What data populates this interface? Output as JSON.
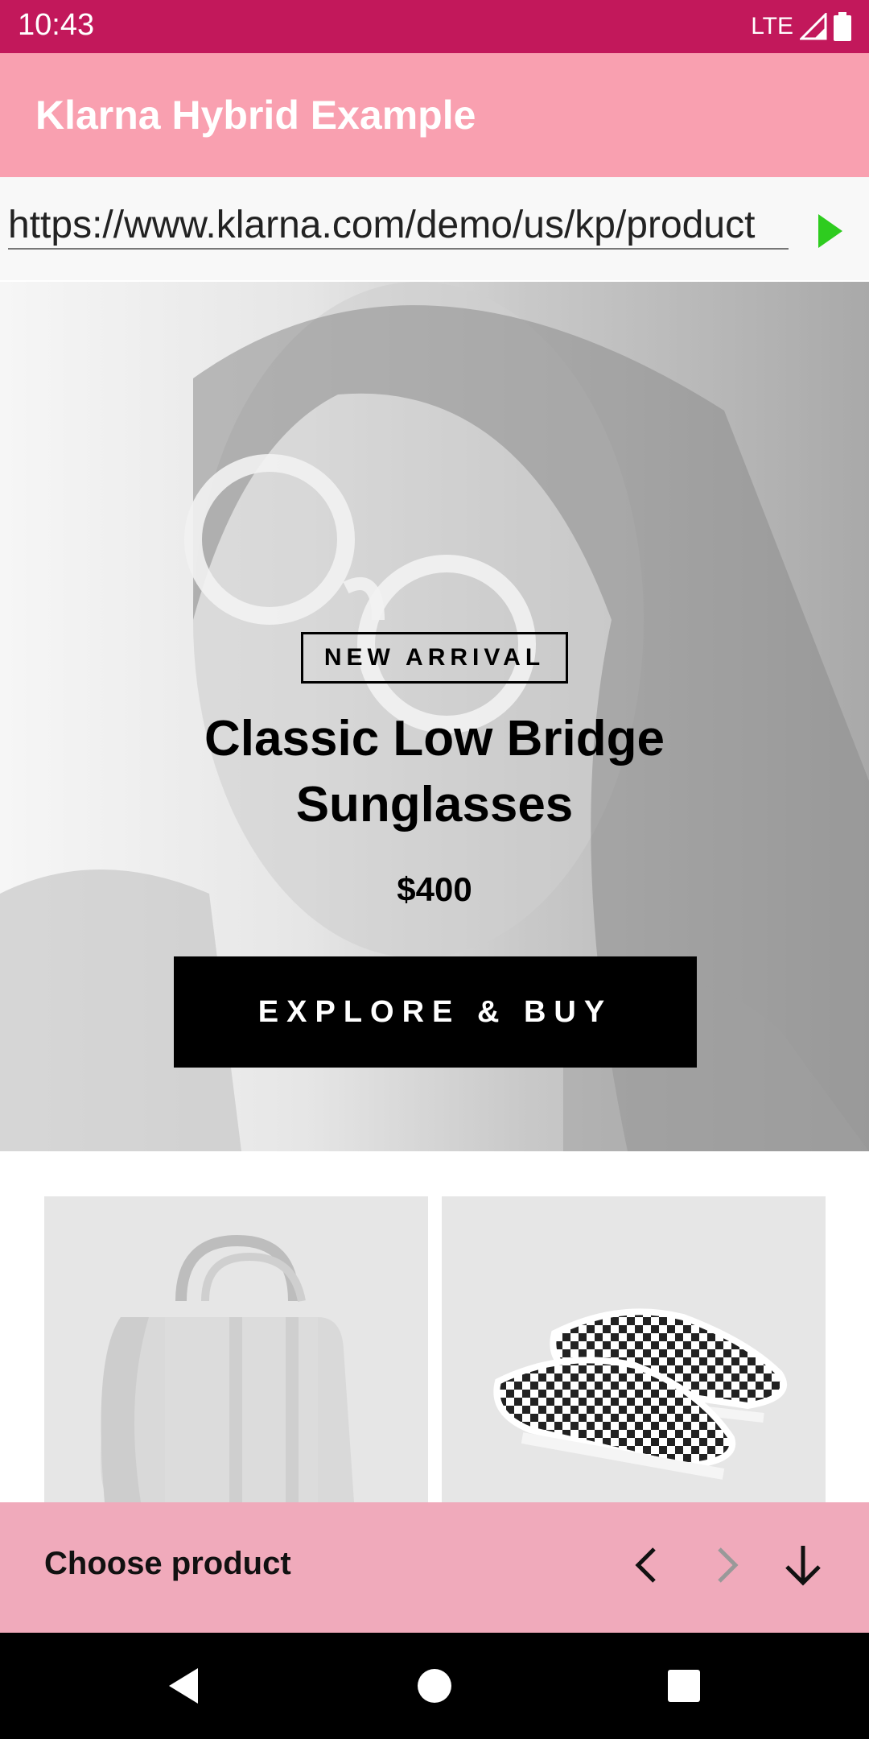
{
  "status_bar": {
    "time": "10:43",
    "network": "LTE"
  },
  "app": {
    "title": "Klarna Hybrid Example"
  },
  "url_bar": {
    "value": "https://www.klarna.com/demo/us/kp/product"
  },
  "hero": {
    "badge": "NEW ARRIVAL",
    "title_line1": "Classic Low Bridge",
    "title_line2": "Sunglasses",
    "price": "$400",
    "cta": "EXPLORE & BUY"
  },
  "bottom_bar": {
    "label": "Choose product"
  },
  "colors": {
    "status_bar": "#c2185b",
    "app_bar": "#f9a0b0",
    "bottom_bar": "#f0aabb",
    "go_button": "#2ecc1f"
  }
}
